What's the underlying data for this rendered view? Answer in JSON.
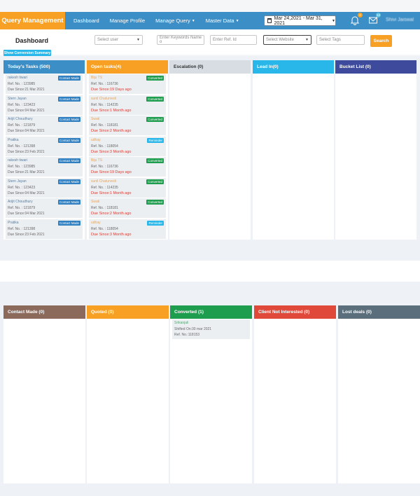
{
  "nav": {
    "brand": "Query Management",
    "items": [
      {
        "label": "Dashboard",
        "caret": false
      },
      {
        "label": "Manage Profile",
        "caret": false
      },
      {
        "label": "Manage Query",
        "caret": true
      },
      {
        "label": "Master Data",
        "caret": true
      }
    ],
    "date_range": "Mar 24,2021 - Mar 31, 2021",
    "bell_count": "0",
    "mail_count": "12",
    "username": "Shivi Jaiswal"
  },
  "filters": {
    "title": "Dashboard",
    "select_user": "Select user",
    "keywords_placeholder": "Enter Keywords Name o",
    "ref_placeholder": "Enter Ref. Id",
    "website": "Select Website",
    "tags_placeholder": "Select Tags",
    "search_label": "Search",
    "conversion_label": "Show Conversion Summary"
  },
  "colors": {
    "nav": "#3b8ec6",
    "accent": "#f7a023",
    "today": "#3b8ec6",
    "open": "#f7a023",
    "escalation": "#d7dde2",
    "lead_in": "#29b6e8",
    "bucket": "#3e4a9c",
    "contact_made": "#8b6a5c",
    "quoted": "#f7a023",
    "converted": "#1f9d4f",
    "not_interested": "#e0483a",
    "lost": "#5a6e7c"
  },
  "board1": [
    {
      "title": "Today's Tasks (500)",
      "color": "today",
      "cards": [
        {
          "name": "rakesh tiwari",
          "ref": "Ref. No. : 123985",
          "due": "Due Since:21 Mar 2021",
          "tag": "Contact Made",
          "tagc": "blue"
        },
        {
          "name": "Stern Jayan",
          "ref": "Ref. No. : 123423",
          "due": "Due Since:04 Mar 2021",
          "tag": "Contact Made",
          "tagc": "blue"
        },
        {
          "name": "Arijit Choudhury",
          "ref": "Ref. No. : 121879",
          "due": "Due Since:04 Mar 2021",
          "tag": "Contact Made",
          "tagc": "blue"
        },
        {
          "name": "Pratika",
          "ref": "Ref. No. : 121398",
          "due": "Due Since:23 Feb 2021",
          "tag": "Contact Made",
          "tagc": "blue"
        },
        {
          "name": "rakesh tiwari",
          "ref": "Ref. No. : 123985",
          "due": "Due Since:21 Mar 2021",
          "tag": "Contact Made",
          "tagc": "blue"
        },
        {
          "name": "Stern Jayan",
          "ref": "Ref. No. : 123423",
          "due": "Due Since:04 Mar 2021",
          "tag": "Contact Made",
          "tagc": "blue"
        },
        {
          "name": "Arijit Choudhury",
          "ref": "Ref. No. : 121879",
          "due": "Due Since:04 Mar 2021",
          "tag": "Contact Made",
          "tagc": "blue"
        },
        {
          "name": "Pratika",
          "ref": "Ref. No. : 121398",
          "due": "Due Since:23 Feb 2021",
          "tag": "Contact Made",
          "tagc": "blue"
        }
      ]
    },
    {
      "title": "Open tasks(4)",
      "color": "open",
      "cards": [
        {
          "name": "Biju TS",
          "ref": "Ref. No. : 116736",
          "due": "Due Since:19 Days ago",
          "tag": "Converted",
          "tagc": "green",
          "red": true
        },
        {
          "name": "sunil Chaturvedi",
          "ref": "Ref. No. : 114235",
          "due": "Due Since:1 Month ago",
          "tag": "Converted",
          "tagc": "green",
          "red": true
        },
        {
          "name": "Swati",
          "ref": "Ref. No. : 118181",
          "due": "Due Since:2 Month ago",
          "tag": "Converted",
          "tagc": "green",
          "red": true
        },
        {
          "name": "udhay",
          "ref": "Ref. No. : 118054",
          "due": "Due Since:3 Month ago",
          "tag": "Reminder",
          "tagc": "cyan",
          "red": true
        },
        {
          "name": "Biju TS",
          "ref": "Ref. No. : 116736",
          "due": "Due Since:19 Days ago",
          "tag": "Converted",
          "tagc": "green",
          "red": true
        },
        {
          "name": "sunil Chaturvedi",
          "ref": "Ref. No. : 114235",
          "due": "Due Since:1 Month ago",
          "tag": "Converted",
          "tagc": "green",
          "red": true
        },
        {
          "name": "Swati",
          "ref": "Ref. No. : 118181",
          "due": "Due Since:2 Month ago",
          "tag": "Converted",
          "tagc": "green",
          "red": true
        },
        {
          "name": "udhay",
          "ref": "Ref. No. : 118054",
          "due": "Due Since:3 Month ago",
          "tag": "Reminder",
          "tagc": "cyan",
          "red": true
        }
      ]
    },
    {
      "title": "Escalation (0)",
      "color": "escalation",
      "cards": []
    },
    {
      "title": "Lead In(0)",
      "color": "lead_in",
      "cards": []
    },
    {
      "title": "Bucket List (0)",
      "color": "bucket",
      "cards": []
    }
  ],
  "board2": [
    {
      "title": "Contact Made (0)",
      "color": "contact_made",
      "cards": []
    },
    {
      "title": "Quoted (0)",
      "color": "quoted",
      "cards": []
    },
    {
      "title": "Converted (1)",
      "color": "converted",
      "cards": [
        {
          "name": "Srikanjali",
          "ref": "Shifted On:30 mar 2021",
          "due": "Ref. No.:118153",
          "tag": "",
          "tagc": ""
        }
      ]
    },
    {
      "title": "Client Not Interested (0)",
      "color": "not_interested",
      "cards": []
    },
    {
      "title": "Lost deals (0)",
      "color": "lost",
      "cards": []
    }
  ]
}
